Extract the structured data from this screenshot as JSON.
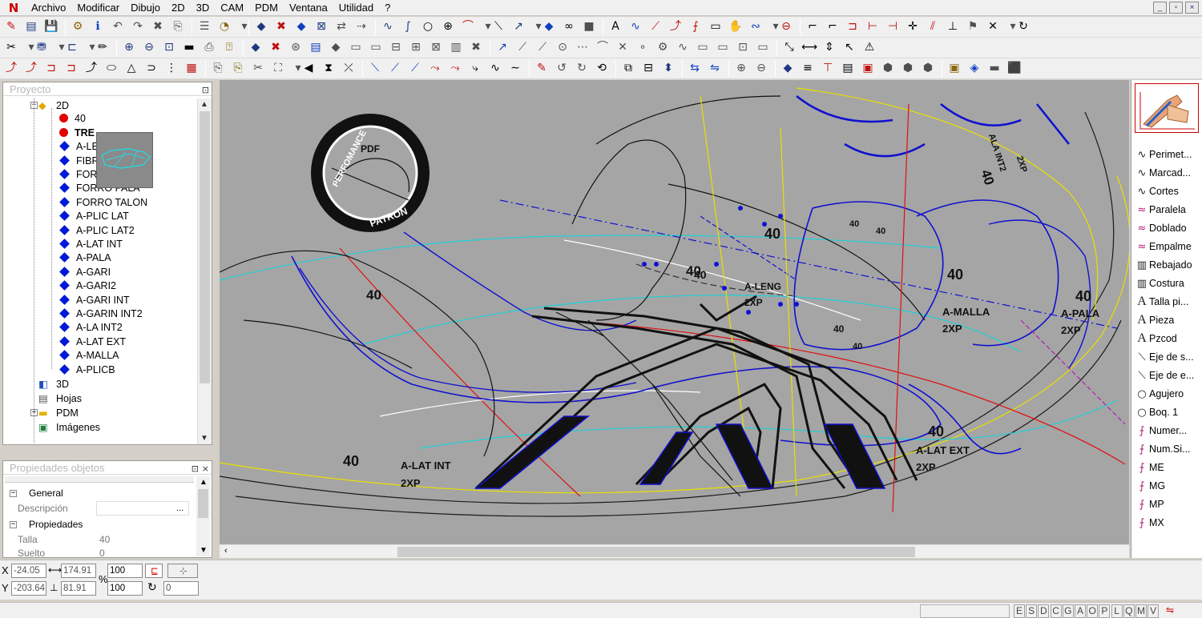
{
  "app": {
    "logo": "N"
  },
  "menu": [
    "Archivo",
    "Modificar",
    "Dibujo",
    "2D",
    "3D",
    "CAM",
    "PDM",
    "Ventana",
    "Utilidad",
    "?"
  ],
  "window_buttons": [
    "_",
    "▫",
    "×"
  ],
  "project_panel": {
    "title": "Proyecto",
    "tree": [
      {
        "label": "2D",
        "type": "folder2d",
        "level": 2,
        "expanded": true
      },
      {
        "label": "40",
        "type": "red",
        "level": 3
      },
      {
        "label": "TRE",
        "type": "red",
        "level": 3,
        "bold": true
      },
      {
        "label": "A-LE",
        "type": "piece",
        "level": 3
      },
      {
        "label": "FIBR",
        "type": "piece",
        "level": 3
      },
      {
        "label": "FOR",
        "type": "piece",
        "level": 3
      },
      {
        "label": "FORRO PALA",
        "type": "piece",
        "level": 3
      },
      {
        "label": "FORRO TALON",
        "type": "piece",
        "level": 3
      },
      {
        "label": "A-PLIC LAT",
        "type": "piece",
        "level": 3
      },
      {
        "label": "A-PLIC LAT2",
        "type": "piece",
        "level": 3
      },
      {
        "label": "A-LAT INT",
        "type": "piece",
        "level": 3
      },
      {
        "label": "A-PALA",
        "type": "piece",
        "level": 3
      },
      {
        "label": "A-GARI",
        "type": "piece",
        "level": 3
      },
      {
        "label": "A-GARI2",
        "type": "piece",
        "level": 3
      },
      {
        "label": "A-GARI INT",
        "type": "piece",
        "level": 3
      },
      {
        "label": "A-GARIN INT2",
        "type": "piece",
        "level": 3
      },
      {
        "label": "A-LA INT2",
        "type": "piece",
        "level": 3
      },
      {
        "label": "A-LAT EXT",
        "type": "piece",
        "level": 3
      },
      {
        "label": "A-MALLA",
        "type": "piece",
        "level": 3
      },
      {
        "label": "A-PLICB",
        "type": "piece",
        "level": 3
      },
      {
        "label": "3D",
        "type": "folder3d",
        "level": 2
      },
      {
        "label": "Hojas",
        "type": "doc",
        "level": 2
      },
      {
        "label": "PDM",
        "type": "folder",
        "level": 2,
        "collapsed": true
      },
      {
        "label": "Imágenes",
        "type": "img",
        "level": 2
      }
    ]
  },
  "properties_panel": {
    "title": "Propiedades objetos",
    "sections": [
      {
        "label": "General",
        "rows": [
          {
            "name": "Descripción",
            "value": ""
          }
        ]
      },
      {
        "label": "Propiedades",
        "rows": [
          {
            "name": "Talla",
            "value": "40"
          },
          {
            "name": "Suelto",
            "value": "0"
          }
        ]
      }
    ]
  },
  "canvas": {
    "logo_text_top": "PERFOMANCE",
    "logo_text_mid": "PDF",
    "logo_text_bottom": "PATRON",
    "labels": [
      {
        "text": "A-LAT INT",
        "sub": "2XP",
        "size": "40"
      },
      {
        "text": "A-LENG",
        "sub": "2XP",
        "size": "40"
      },
      {
        "text": "A-MALLA",
        "sub": "2XP",
        "size": "40"
      },
      {
        "text": "A-PALA",
        "sub": "2XP",
        "size": "40"
      },
      {
        "text": "A-LAT EXT",
        "sub": "2XP",
        "size": "40"
      },
      {
        "text": "ALA INT2",
        "sub": "2XP",
        "size": "40"
      }
    ],
    "extra_sizes": [
      "40",
      "40",
      "40",
      "40",
      "40",
      "40",
      "40"
    ]
  },
  "right_panel": {
    "items": [
      {
        "label": "Perimet...",
        "icon": "curve-icon"
      },
      {
        "label": "Marcad...",
        "icon": "curve-icon"
      },
      {
        "label": "Cortes",
        "icon": "curve-icon"
      },
      {
        "label": "Paralela",
        "icon": "parallel-icon"
      },
      {
        "label": "Doblado",
        "icon": "parallel-icon"
      },
      {
        "label": "Empalme",
        "icon": "parallel-icon"
      },
      {
        "label": "Rebajado",
        "icon": "stitch-icon"
      },
      {
        "label": "Costura",
        "icon": "stitch-icon"
      },
      {
        "label": "Talla pi...",
        "icon": "text-a-icon"
      },
      {
        "label": "Pieza",
        "icon": "text-a-icon"
      },
      {
        "label": "Pzcod",
        "icon": "text-a-icon"
      },
      {
        "label": "Eje de s...",
        "icon": "axis-icon"
      },
      {
        "label": "Eje de e...",
        "icon": "axis-icon"
      },
      {
        "label": "Agujero",
        "icon": "circle-icon"
      },
      {
        "label": "Boq. 1",
        "icon": "circle-icon"
      },
      {
        "label": "Numer...",
        "icon": "notch-icon"
      },
      {
        "label": "Num.Si...",
        "icon": "notch-icon"
      },
      {
        "label": "ME",
        "icon": "notch-icon"
      },
      {
        "label": "MG",
        "icon": "notch-icon"
      },
      {
        "label": "MP",
        "icon": "notch-icon"
      },
      {
        "label": "MX",
        "icon": "notch-icon"
      }
    ]
  },
  "coords": {
    "x_label": "X",
    "y_label": "Y",
    "x": "-24.05",
    "y": "-203.64",
    "dx": "174.91",
    "dy": "81.91",
    "pct_label": "%",
    "zoom1": "100",
    "zoom2": "100",
    "angle": "0"
  },
  "status_letters": [
    "E",
    "S",
    "D",
    "C",
    "G",
    "A",
    "O",
    "P",
    "L",
    "Q",
    "M",
    "V"
  ]
}
